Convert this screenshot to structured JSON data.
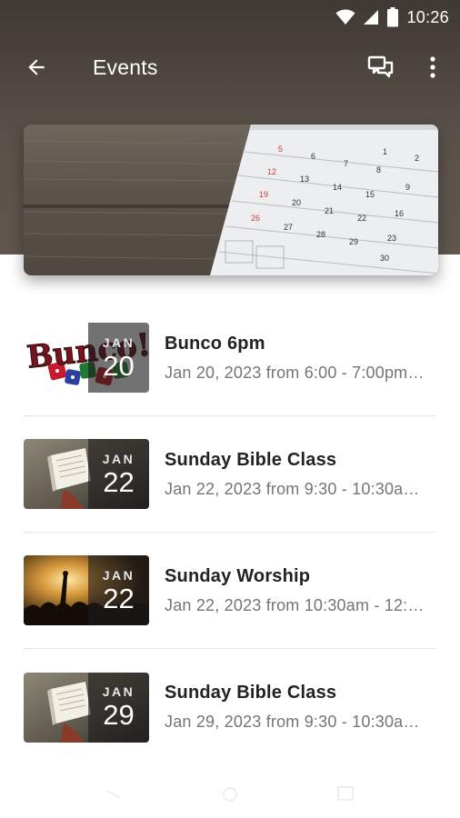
{
  "status_bar": {
    "time": "10:26",
    "icons": [
      "wifi-icon",
      "cell-signal-icon",
      "battery-icon"
    ]
  },
  "toolbar": {
    "title": "Events",
    "back_icon": "arrow-left-icon",
    "actions": [
      "chat-bubbles-icon",
      "more-vert-icon"
    ]
  },
  "banner": {
    "image": "calendar-on-wood-photo",
    "calendar_numbers": [
      "5",
      "6",
      "7",
      "8",
      "1",
      "2",
      "12",
      "13",
      "14",
      "15",
      "9",
      "19",
      "20",
      "21",
      "22",
      "16",
      "26",
      "27",
      "28",
      "29",
      "23",
      "30"
    ]
  },
  "events": [
    {
      "title": "Bunco 6pm",
      "subtitle": "Jan 20, 2023 from 6:00 - 7:00pm…",
      "month": "JAN",
      "day": "20",
      "thumb_text": "Bunco!",
      "thumb": "bunco-dice-image"
    },
    {
      "title": "Sunday Bible Class",
      "subtitle": "Jan 22, 2023 from 9:30 - 10:30a…",
      "month": "JAN",
      "day": "22",
      "thumb": "open-bible-photo"
    },
    {
      "title": "Sunday Worship",
      "subtitle": "Jan 22, 2023 from 10:30am - 12:…",
      "month": "JAN",
      "day": "22",
      "thumb": "worship-crowd-photo"
    },
    {
      "title": "Sunday Bible Class",
      "subtitle": "Jan 29, 2023 from 9:30 - 10:30a…",
      "month": "JAN",
      "day": "29",
      "thumb": "open-bible-photo"
    }
  ],
  "colors": {
    "header": "#5a524a",
    "title_text": "#222222",
    "subtitle_text": "#757575",
    "calendar_red": "#d23a3a"
  }
}
